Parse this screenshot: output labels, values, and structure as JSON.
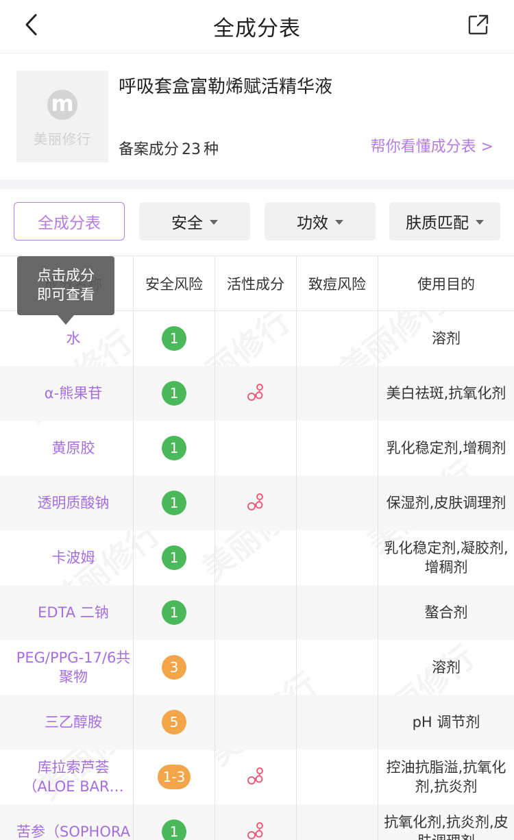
{
  "nav": {
    "title": "全成分表"
  },
  "product": {
    "logo_text": "美丽修行",
    "name": "呼吸套盒富勒烯赋活精华液",
    "count_prefix": "备案成分",
    "count": "23",
    "count_suffix": "种",
    "help_link": "帮你看懂成分表 >"
  },
  "filters": [
    {
      "label": "全成分表"
    },
    {
      "label": "安全"
    },
    {
      "label": "功效"
    },
    {
      "label": "肤质匹配"
    }
  ],
  "table": {
    "columns": [
      "成分名称",
      "安全风险",
      "活性成分",
      "致痘风险",
      "使用目的"
    ],
    "rows": [
      {
        "name": "水",
        "risk": "1",
        "risk_color": "green",
        "active": false,
        "purpose": "溶剂"
      },
      {
        "name": "α-熊果苷",
        "risk": "1",
        "risk_color": "green",
        "active": true,
        "purpose": "美白祛斑,抗氧化剂"
      },
      {
        "name": "黄原胶",
        "risk": "1",
        "risk_color": "green",
        "active": false,
        "purpose": "乳化稳定剂,增稠剂"
      },
      {
        "name": "透明质酸钠",
        "risk": "1",
        "risk_color": "green",
        "active": true,
        "purpose": "保湿剂,皮肤调理剂"
      },
      {
        "name": "卡波姆",
        "risk": "1",
        "risk_color": "green",
        "active": false,
        "purpose": "乳化稳定剂,凝胶剂,增稠剂"
      },
      {
        "name": "EDTA 二钠",
        "risk": "1",
        "risk_color": "green",
        "active": false,
        "purpose": "螯合剂"
      },
      {
        "name": "PEG/PPG-17/6共聚物",
        "risk": "3",
        "risk_color": "orange",
        "active": false,
        "purpose": "溶剂"
      },
      {
        "name": "三乙醇胺",
        "risk": "5",
        "risk_color": "orange",
        "active": false,
        "purpose": "pH 调节剂"
      },
      {
        "name": "库拉索芦荟（ALOE BAR…",
        "risk": "1-3",
        "risk_color": "orange",
        "active": true,
        "purpose": "控油抗脂溢,抗氧化剂,抗炎剂"
      },
      {
        "name": "苦参（SOPHORA",
        "risk": "1",
        "risk_color": "green",
        "active": true,
        "purpose": "抗氧化剂,抗炎剂,皮肤调理剂"
      }
    ]
  },
  "tooltip": {
    "line1": "点击成分",
    "line2": "即可查看"
  },
  "colors": {
    "accent": "#b77ce2",
    "safe": "#4cb85c",
    "warn": "#f3a54a"
  },
  "watermark_text": "美丽修行"
}
